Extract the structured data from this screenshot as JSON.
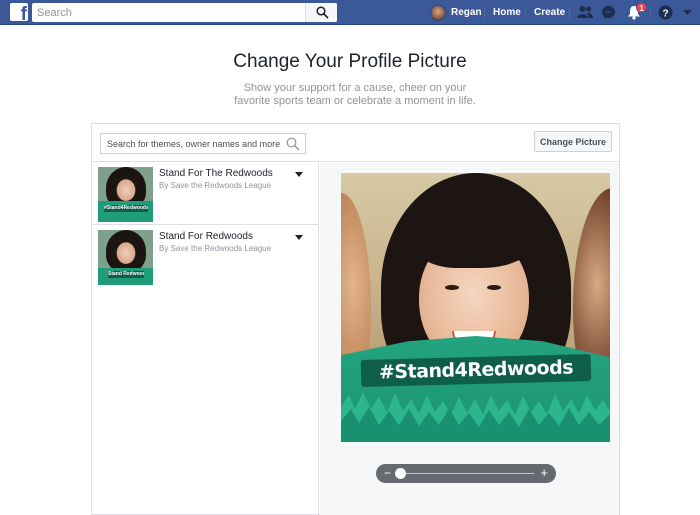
{
  "topbar": {
    "logo_letter": "f",
    "search_placeholder": "Search",
    "user_name": "Regan",
    "links": [
      "Home",
      "Create"
    ],
    "notification_count": "1",
    "help_label": "?"
  },
  "page": {
    "title": "Change Your Profile Picture",
    "subtitle": "Show your support for a cause, cheer on your favorite sports team or celebrate a moment in life."
  },
  "panel": {
    "theme_search_placeholder": "Search for themes, owner names and more.",
    "change_picture_label": "Change Picture",
    "frames": [
      {
        "name": "Stand For The Redwoods",
        "author": "By Save the Redwoods League",
        "thumb_label": "#Stand4Redwoods"
      },
      {
        "name": "Stand For Redwoods",
        "author": "By Save the Redwoods League",
        "thumb_label": "Stand Redwoods"
      }
    ],
    "preview_banner_text": "#Stand4Redwoods",
    "zoom": {
      "minus": "−",
      "plus": "+",
      "level": 0.0
    }
  },
  "colors": {
    "brand": "#3b5998",
    "frame_green": "#1f9c79",
    "badge_red": "#fa3e3e"
  }
}
